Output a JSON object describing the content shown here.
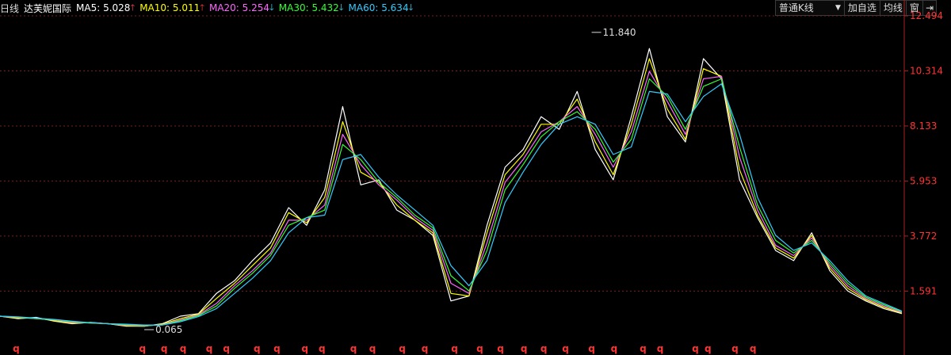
{
  "header": {
    "period": "日线",
    "stock_name": "达芙妮国际",
    "ma": [
      {
        "label": "MA5: 5.028",
        "trend": "up",
        "color": "#ffffff",
        "arrow_color": "#ff4040"
      },
      {
        "label": "MA10: 5.011",
        "trend": "up",
        "color": "#ffff00",
        "arrow_color": "#ff4040"
      },
      {
        "label": "MA20: 5.254",
        "trend": "down",
        "color": "#ff66ff",
        "arrow_color": "#40e0ff"
      },
      {
        "label": "MA30: 5.432",
        "trend": "down",
        "color": "#33ff33",
        "arrow_color": "#40e0ff"
      },
      {
        "label": "MA60: 5.634",
        "trend": "down",
        "color": "#33ccff",
        "arrow_color": "#40e0ff"
      }
    ]
  },
  "toolbar": {
    "kline_type": "普通K线",
    "add_watch": "加自选",
    "avg_line": "均线",
    "window": "窗"
  },
  "chart_data": {
    "type": "line",
    "title": "",
    "ylabel": "",
    "ylim": [
      0.065,
      12.494
    ],
    "y_ticks": [
      1.591,
      3.772,
      5.953,
      8.133,
      10.314,
      12.494
    ],
    "y_tick_labels": [
      "1.591",
      "3.772",
      "5.953",
      "8.133",
      "10.314",
      "12.494"
    ],
    "grid": "horizontal-dotted",
    "annotations": [
      {
        "label": "11.840",
        "kind": "max",
        "x": 0.656,
        "y": 11.84
      },
      {
        "label": "0.065",
        "kind": "min",
        "x": 0.16,
        "y": 0.065
      }
    ],
    "x_markers": {
      "label": "q",
      "color": "#ff3333",
      "x": [
        0.018,
        0.158,
        0.182,
        0.203,
        0.232,
        0.251,
        0.285,
        0.307,
        0.338,
        0.357,
        0.392,
        0.413,
        0.446,
        0.471,
        0.504,
        0.532,
        0.555,
        0.581,
        0.603,
        0.627,
        0.656,
        0.681,
        0.713,
        0.732,
        0.771,
        0.785,
        0.815,
        0.835
      ]
    },
    "series": [
      {
        "color": "#ffffff",
        "x": [
          0,
          0.02,
          0.04,
          0.06,
          0.08,
          0.1,
          0.12,
          0.14,
          0.16,
          0.18,
          0.2,
          0.22,
          0.24,
          0.26,
          0.28,
          0.3,
          0.32,
          0.34,
          0.36,
          0.38,
          0.4,
          0.42,
          0.44,
          0.46,
          0.48,
          0.5,
          0.52,
          0.54,
          0.56,
          0.58,
          0.6,
          0.62,
          0.64,
          0.66,
          0.68,
          0.7,
          0.72,
          0.74,
          0.76,
          0.78,
          0.8,
          0.82,
          0.84,
          0.86,
          0.88,
          0.9,
          0.92,
          0.94,
          0.96,
          0.98,
          1.0
        ],
        "values": [
          0.6,
          0.5,
          0.55,
          0.4,
          0.3,
          0.35,
          0.3,
          0.2,
          0.2,
          0.3,
          0.6,
          0.7,
          1.5,
          2.0,
          2.8,
          3.5,
          4.9,
          4.2,
          5.6,
          8.9,
          5.8,
          6.0,
          4.8,
          4.4,
          3.8,
          1.2,
          1.4,
          4.2,
          6.5,
          7.2,
          8.5,
          8.0,
          9.5,
          7.2,
          6.0,
          8.5,
          11.2,
          8.5,
          7.5,
          10.8,
          10.0,
          6.0,
          4.5,
          3.2,
          2.8,
          3.9,
          2.4,
          1.6,
          1.2,
          0.9,
          0.7
        ]
      },
      {
        "color": "#ffff00",
        "x": [
          0,
          0.02,
          0.04,
          0.06,
          0.08,
          0.1,
          0.12,
          0.14,
          0.16,
          0.18,
          0.2,
          0.22,
          0.24,
          0.26,
          0.28,
          0.3,
          0.32,
          0.34,
          0.36,
          0.38,
          0.4,
          0.42,
          0.44,
          0.46,
          0.48,
          0.5,
          0.52,
          0.54,
          0.56,
          0.58,
          0.6,
          0.62,
          0.64,
          0.66,
          0.68,
          0.7,
          0.72,
          0.74,
          0.76,
          0.78,
          0.8,
          0.82,
          0.84,
          0.86,
          0.88,
          0.9,
          0.92,
          0.94,
          0.96,
          0.98,
          1.0
        ],
        "values": [
          0.6,
          0.52,
          0.52,
          0.42,
          0.32,
          0.34,
          0.3,
          0.22,
          0.2,
          0.28,
          0.5,
          0.68,
          1.3,
          1.9,
          2.6,
          3.3,
          4.7,
          4.3,
          5.3,
          8.3,
          6.3,
          5.9,
          5.0,
          4.4,
          3.9,
          1.5,
          1.4,
          3.9,
          6.2,
          7.0,
          8.2,
          8.2,
          9.2,
          7.5,
          6.2,
          8.2,
          10.8,
          8.8,
          7.6,
          10.4,
          10.1,
          6.4,
          4.6,
          3.3,
          2.9,
          3.8,
          2.5,
          1.7,
          1.25,
          0.95,
          0.72
        ]
      },
      {
        "color": "#ff66ff",
        "x": [
          0,
          0.02,
          0.04,
          0.06,
          0.08,
          0.1,
          0.12,
          0.14,
          0.16,
          0.18,
          0.2,
          0.22,
          0.24,
          0.26,
          0.28,
          0.3,
          0.32,
          0.34,
          0.36,
          0.38,
          0.4,
          0.42,
          0.44,
          0.46,
          0.48,
          0.5,
          0.52,
          0.54,
          0.56,
          0.58,
          0.6,
          0.62,
          0.64,
          0.66,
          0.68,
          0.7,
          0.72,
          0.74,
          0.76,
          0.78,
          0.8,
          0.82,
          0.84,
          0.86,
          0.88,
          0.9,
          0.92,
          0.94,
          0.96,
          0.98,
          1.0
        ],
        "values": [
          0.6,
          0.55,
          0.5,
          0.45,
          0.35,
          0.33,
          0.3,
          0.24,
          0.22,
          0.26,
          0.45,
          0.65,
          1.1,
          1.8,
          2.4,
          3.1,
          4.4,
          4.4,
          5.0,
          7.8,
          6.6,
          5.8,
          5.2,
          4.5,
          4.0,
          1.9,
          1.5,
          3.5,
          5.9,
          6.8,
          7.9,
          8.3,
          8.9,
          7.8,
          6.5,
          7.9,
          10.3,
          9.1,
          7.8,
          10.0,
          10.1,
          6.9,
          4.8,
          3.4,
          3.0,
          3.7,
          2.6,
          1.8,
          1.3,
          1.0,
          0.75
        ]
      },
      {
        "color": "#33ff33",
        "x": [
          0,
          0.02,
          0.04,
          0.06,
          0.08,
          0.1,
          0.12,
          0.14,
          0.16,
          0.18,
          0.2,
          0.22,
          0.24,
          0.26,
          0.28,
          0.3,
          0.32,
          0.34,
          0.36,
          0.38,
          0.4,
          0.42,
          0.44,
          0.46,
          0.48,
          0.5,
          0.52,
          0.54,
          0.56,
          0.58,
          0.6,
          0.62,
          0.64,
          0.66,
          0.68,
          0.7,
          0.72,
          0.74,
          0.76,
          0.78,
          0.8,
          0.82,
          0.84,
          0.86,
          0.88,
          0.9,
          0.92,
          0.94,
          0.96,
          0.98,
          1.0
        ],
        "values": [
          0.6,
          0.56,
          0.5,
          0.46,
          0.38,
          0.33,
          0.3,
          0.26,
          0.23,
          0.25,
          0.42,
          0.62,
          1.0,
          1.7,
          2.3,
          3.0,
          4.2,
          4.5,
          4.8,
          7.4,
          6.8,
          5.9,
          5.3,
          4.6,
          4.1,
          2.2,
          1.6,
          3.2,
          5.6,
          6.6,
          7.7,
          8.3,
          8.7,
          8.0,
          6.7,
          7.6,
          10.0,
          9.3,
          8.0,
          9.7,
          10.0,
          7.3,
          5.0,
          3.6,
          3.1,
          3.6,
          2.7,
          1.9,
          1.35,
          1.05,
          0.78
        ]
      },
      {
        "color": "#33ccff",
        "x": [
          0,
          0.02,
          0.04,
          0.06,
          0.08,
          0.1,
          0.12,
          0.14,
          0.16,
          0.18,
          0.2,
          0.22,
          0.24,
          0.26,
          0.28,
          0.3,
          0.32,
          0.34,
          0.36,
          0.38,
          0.4,
          0.42,
          0.44,
          0.46,
          0.48,
          0.5,
          0.52,
          0.54,
          0.56,
          0.58,
          0.6,
          0.62,
          0.64,
          0.66,
          0.68,
          0.7,
          0.72,
          0.74,
          0.76,
          0.78,
          0.8,
          0.82,
          0.84,
          0.86,
          0.88,
          0.9,
          0.92,
          0.94,
          0.96,
          0.98,
          1.0
        ],
        "values": [
          0.6,
          0.57,
          0.52,
          0.47,
          0.4,
          0.34,
          0.3,
          0.28,
          0.25,
          0.25,
          0.38,
          0.58,
          0.9,
          1.5,
          2.1,
          2.8,
          3.9,
          4.5,
          4.6,
          6.8,
          7.0,
          6.1,
          5.4,
          4.8,
          4.2,
          2.6,
          1.8,
          2.8,
          5.1,
          6.3,
          7.4,
          8.2,
          8.5,
          8.2,
          7.0,
          7.3,
          9.5,
          9.4,
          8.3,
          9.3,
          9.8,
          7.8,
          5.3,
          3.8,
          3.2,
          3.5,
          2.8,
          2.0,
          1.4,
          1.1,
          0.8
        ]
      }
    ]
  }
}
